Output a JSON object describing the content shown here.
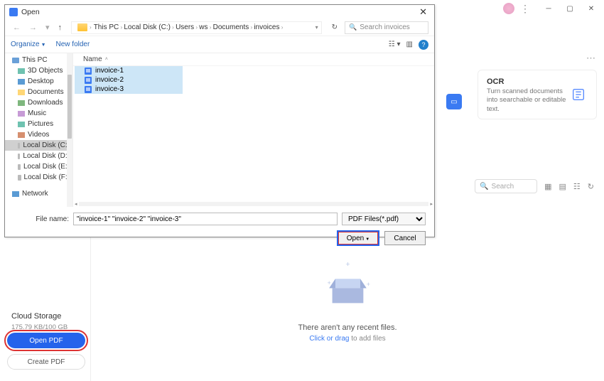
{
  "app": {
    "ocr_card": {
      "title": "OCR",
      "desc": "Turn scanned documents into searchable or editable text."
    },
    "search_placeholder": "Search",
    "empty_msg": "There aren't any recent files.",
    "empty_action_link": "Click or drag",
    "empty_action_rest": " to add files",
    "cloud_title": "Cloud Storage",
    "cloud_size": "175.79 KB/100 GB",
    "open_pdf_btn": "Open PDF",
    "create_pdf_btn": "Create PDF"
  },
  "dialog": {
    "title": "Open",
    "breadcrumb": [
      "This PC",
      "Local Disk (C:)",
      "Users",
      "ws",
      "Documents",
      "invoices"
    ],
    "search_placeholder": "Search invoices",
    "organize": "Organize",
    "new_folder": "New folder",
    "col_name": "Name",
    "tree": [
      {
        "label": "This PC",
        "icon": "ic-pc",
        "level": "l1"
      },
      {
        "label": "3D Objects",
        "icon": "ic-3d"
      },
      {
        "label": "Desktop",
        "icon": "ic-desk"
      },
      {
        "label": "Documents",
        "icon": "ic-doc"
      },
      {
        "label": "Downloads",
        "icon": "ic-dl"
      },
      {
        "label": "Music",
        "icon": "ic-music"
      },
      {
        "label": "Pictures",
        "icon": "ic-pic"
      },
      {
        "label": "Videos",
        "icon": "ic-vid"
      },
      {
        "label": "Local Disk (C:)",
        "icon": "ic-disk",
        "selected": true
      },
      {
        "label": "Local Disk (D:)",
        "icon": "ic-disk"
      },
      {
        "label": "Local Disk (E:)",
        "icon": "ic-disk"
      },
      {
        "label": "Local Disk (F:)",
        "icon": "ic-disk"
      },
      {
        "label": "Network",
        "icon": "ic-net",
        "level": "l1",
        "gap": true
      }
    ],
    "files": [
      "invoice-1",
      "invoice-2",
      "invoice-3"
    ],
    "filename_label": "File name:",
    "filename_value": "\"invoice-1\" \"invoice-2\" \"invoice-3\"",
    "filetype": "PDF Files(*.pdf)",
    "open_btn": "Open",
    "cancel_btn": "Cancel"
  }
}
